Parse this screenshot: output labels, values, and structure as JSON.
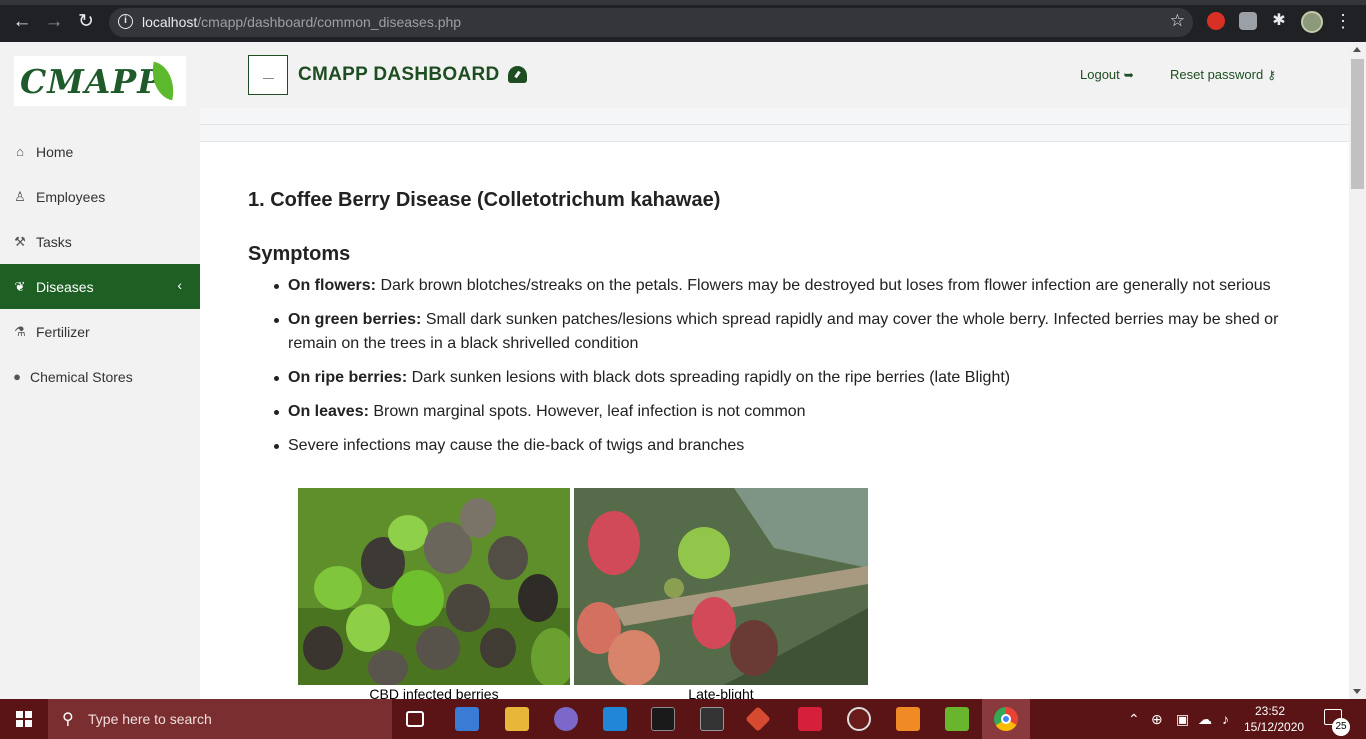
{
  "browser": {
    "url_host": "localhost",
    "url_path": "/cmapp/dashboard/common_diseases.php"
  },
  "sidebar": {
    "logo_text": "CMAPP",
    "items": [
      {
        "label": "Home",
        "icon": "home-icon"
      },
      {
        "label": "Employees",
        "icon": "user-icon"
      },
      {
        "label": "Tasks",
        "icon": "wrench-icon"
      },
      {
        "label": "Diseases",
        "icon": "leaf-icon",
        "active": true
      },
      {
        "label": "Fertilizer",
        "icon": "flask-icon"
      },
      {
        "label": "Chemical Stores",
        "icon": "map-marker-icon"
      }
    ]
  },
  "header": {
    "title": "CMAPP DASHBOARD",
    "logout_label": "Logout",
    "reset_label": "Reset password"
  },
  "main": {
    "disease_title": "1. Coffee Berry Disease (Colletotrichum kahawae)",
    "symptoms_heading": "Symptoms",
    "symptoms": [
      {
        "label": "On flowers:",
        "text": " Dark brown blotches/streaks on the petals. Flowers may be destroyed but loses from flower infection are generally not serious"
      },
      {
        "label": "On green berries:",
        "text": " Small dark sunken patches/lesions which spread rapidly and may cover the whole berry. Infected berries may be shed or remain on the trees in a black shrivelled condition"
      },
      {
        "label": "On ripe berries:",
        "text": " Dark sunken lesions with black dots spreading rapidly on the ripe berries (late Blight)"
      },
      {
        "label": "On leaves:",
        "text": " Brown marginal spots. However, leaf infection is not common"
      },
      {
        "label": "",
        "text": "Severe infections may cause the die-back of twigs and branches"
      }
    ],
    "figures": [
      {
        "caption": "CBD infected berries"
      },
      {
        "caption": "Late-blight"
      }
    ]
  },
  "taskbar": {
    "search_placeholder": "Type here to search",
    "time": "23:52",
    "date": "15/12/2020",
    "notification_count": "25"
  },
  "colors": {
    "brand_green": "#1e5f24",
    "taskbar": "#5a1416"
  }
}
